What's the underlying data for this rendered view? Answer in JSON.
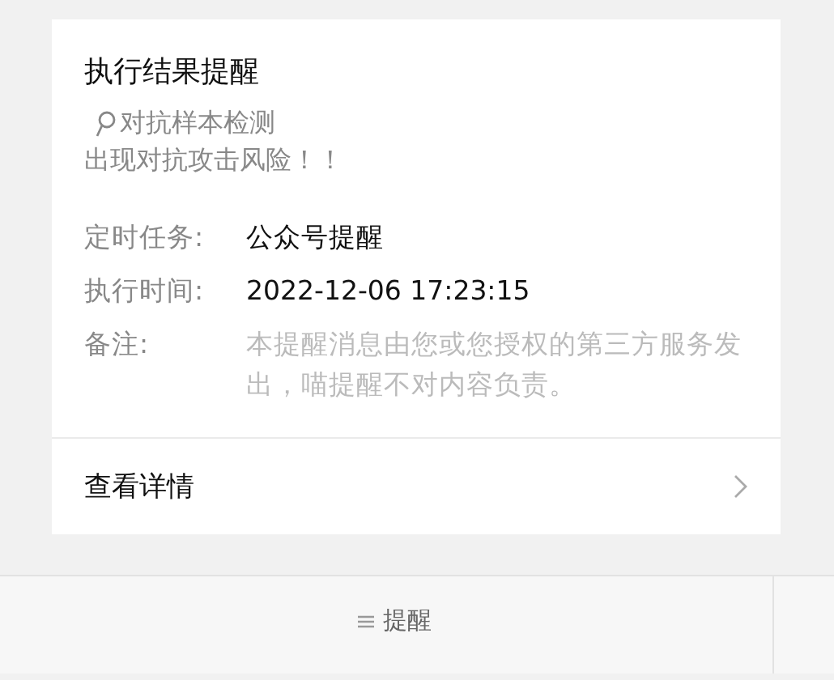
{
  "card": {
    "title": "执行结果提醒",
    "subtitle": "对抗样本检测",
    "message": "出现对抗攻击风险！！",
    "fields": [
      {
        "label": "定时任务:",
        "value": "公众号提醒",
        "kind": "strong"
      },
      {
        "label": "执行时间:",
        "value": "2022-12-06 17:23:15",
        "kind": "strong"
      },
      {
        "label": "备注:",
        "value": "本提醒消息由您或您授权的第三方服务发出，喵提醒不对内容负责。",
        "kind": "muted"
      }
    ],
    "details_link": "查看详情"
  },
  "bottom_menu": {
    "items": [
      "提醒"
    ]
  }
}
